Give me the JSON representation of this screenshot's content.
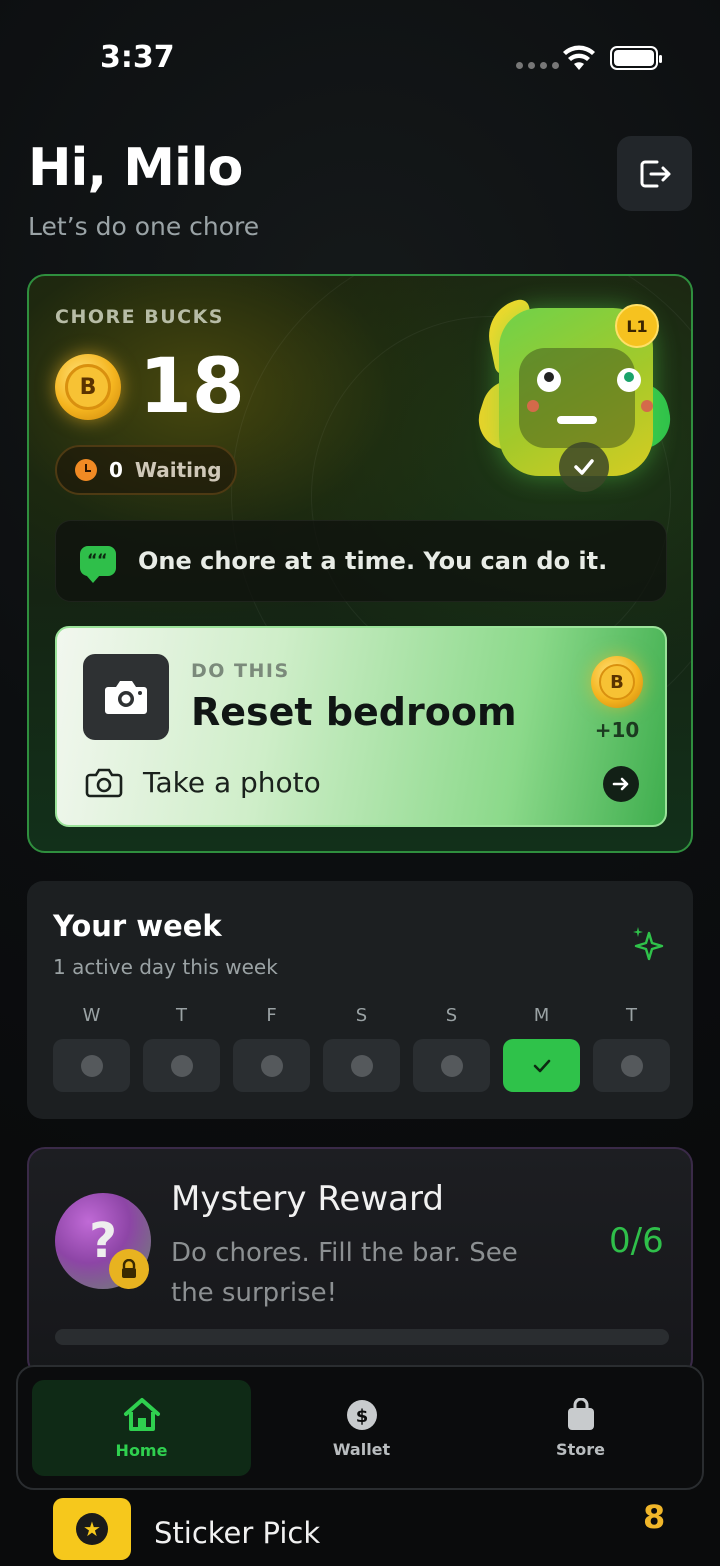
{
  "status_bar": {
    "time": "3:37"
  },
  "header": {
    "greeting": "Hi, Milo",
    "subtitle": "Let’s do one chore"
  },
  "hero": {
    "bucks_label": "CHORE BUCKS",
    "coin_letter": "B",
    "bucks_value": "18",
    "waiting_count": "0",
    "waiting_label": "Waiting",
    "level_badge": "L1",
    "tip_text": "One chore at a time. You can do it.",
    "do_this": {
      "label": "DO THIS",
      "title": "Reset bedroom",
      "reward": "+10",
      "action": "Take a photo"
    }
  },
  "week": {
    "title": "Your week",
    "subtitle": "1 active day this week",
    "days": [
      {
        "letter": "W",
        "done": false
      },
      {
        "letter": "T",
        "done": false
      },
      {
        "letter": "F",
        "done": false
      },
      {
        "letter": "S",
        "done": false
      },
      {
        "letter": "S",
        "done": false
      },
      {
        "letter": "M",
        "done": true
      },
      {
        "letter": "T",
        "done": false
      }
    ]
  },
  "mystery": {
    "title": "Mystery Reward",
    "description": "Do chores. Fill the bar. See the surprise!",
    "progress": "0/6",
    "progress_fraction": 0
  },
  "sticker": {
    "name": "Sticker Pick",
    "count": "8"
  },
  "tabs": [
    {
      "label": "Home",
      "active": true
    },
    {
      "label": "Wallet",
      "active": false
    },
    {
      "label": "Store",
      "active": false
    }
  ],
  "colors": {
    "accent_green": "#2fc24a",
    "coin_gold": "#f5b51f",
    "background": "#0b0d0f"
  }
}
